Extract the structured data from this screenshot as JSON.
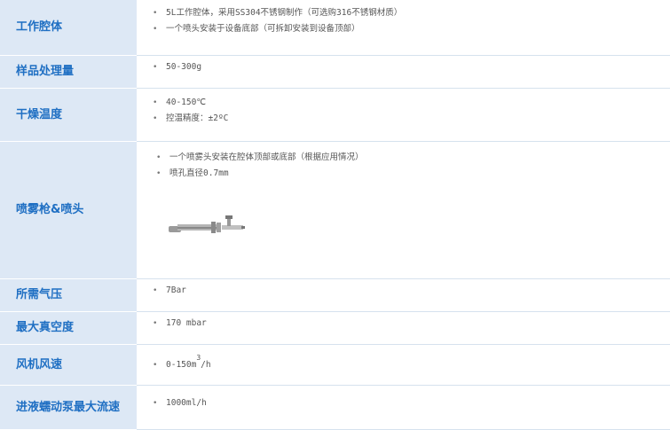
{
  "rows": [
    {
      "label": "工作腔体",
      "items": [
        "5L工作腔体，采用SS304不锈钢制作（可选购316不锈钢材质）",
        "一个喷头安装于设备底部（可拆卸安装到设备顶部）"
      ]
    },
    {
      "label": "样品处理量",
      "items": [
        "50-300g"
      ]
    },
    {
      "label": "干燥温度",
      "items": [
        "40-150℃",
        "控温精度：±2ºC"
      ]
    },
    {
      "label": "喷雾枪&喷头",
      "items": [
        "一个喷雾头安装在腔体顶部或底部（根据应用情况）",
        "喷孔直径0.7mm"
      ]
    },
    {
      "label": "所需气压",
      "items": [
        "7Bar"
      ]
    },
    {
      "label": "最大真空度",
      "items": [
        "170 mbar"
      ]
    },
    {
      "label": "风机风速",
      "items_pre": "0-150m",
      "items_sup": "3",
      "items_post": "/h"
    },
    {
      "label": "进液蠕动泵最大流速",
      "items": [
        "1000ml/h"
      ]
    }
  ]
}
